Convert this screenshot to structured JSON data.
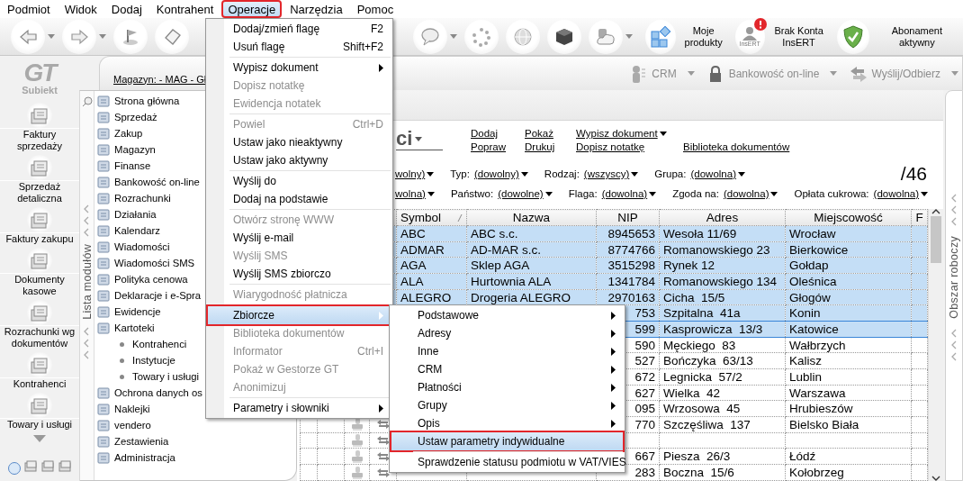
{
  "menu_bar": [
    {
      "label": "Podmiot",
      "selected": false
    },
    {
      "label": "Widok",
      "selected": false
    },
    {
      "label": "Dodaj",
      "selected": false
    },
    {
      "label": "Kontrahent",
      "selected": false
    },
    {
      "label": "Operacje",
      "selected": true
    },
    {
      "label": "Narzędzia",
      "selected": false
    },
    {
      "label": "Pomoc",
      "selected": false
    }
  ],
  "toolbar": {
    "shortcuts": [
      {
        "label": "Moje produkty",
        "alert": false
      },
      {
        "label": "Brak Konta InsERT",
        "icon_caption": "InsERT",
        "alert": true
      },
      {
        "label": "Abonament aktywny",
        "alert": false
      }
    ]
  },
  "left_nav": {
    "logo": {
      "mark": "GT",
      "name": "Subiekt"
    },
    "items": [
      {
        "label": "Faktury sprzedaży"
      },
      {
        "label": "Sprzedaż detaliczna"
      },
      {
        "label": "Faktury zakupu"
      },
      {
        "label": "Dokumenty kasowe"
      },
      {
        "label": "Rozrachunki wg dokumentów"
      },
      {
        "label": "Kontrahenci"
      },
      {
        "label": "Towary i usługi"
      }
    ]
  },
  "sub_bar": {
    "warehouse": "Magazyn: - MAG - Gł",
    "actions": [
      {
        "label": "CRM"
      },
      {
        "label": "Bankowość on-line"
      },
      {
        "label": "Wyślij/Odbierz"
      }
    ]
  },
  "modules": {
    "tab_label": "Lista modułów",
    "items": [
      {
        "label": "Strona główna"
      },
      {
        "label": "Sprzedaż"
      },
      {
        "label": "Zakup"
      },
      {
        "label": "Magazyn"
      },
      {
        "label": "Finanse"
      },
      {
        "label": "Bankowość on-line"
      },
      {
        "label": "Rozrachunki"
      },
      {
        "label": "Działania"
      },
      {
        "label": "Kalendarz"
      },
      {
        "label": "Wiadomości"
      },
      {
        "label": "Wiadomości SMS"
      },
      {
        "label": "Polityka cenowa"
      },
      {
        "label": "Deklaracje i e-Spra"
      },
      {
        "label": "Ewidencje"
      },
      {
        "label": "Kartoteki",
        "children": [
          {
            "label": "Kontrahenci"
          },
          {
            "label": "Instytucje"
          },
          {
            "label": "Towary i usługi"
          }
        ]
      },
      {
        "label": "Ochrona danych os"
      },
      {
        "label": "Naklejki"
      },
      {
        "label": "vendero"
      },
      {
        "label": "Zestawienia"
      },
      {
        "label": "Administracja"
      }
    ]
  },
  "content": {
    "title": "ci",
    "count": "/46",
    "action_rows": [
      [
        {
          "label": "Dodaj",
          "dropdown": false
        },
        {
          "label": "Pokaż",
          "dropdown": false
        },
        {
          "label": "Wypisz dokument",
          "dropdown": true
        }
      ],
      [
        {
          "label": "Popraw",
          "dropdown": false
        },
        {
          "label": "Drukuj",
          "dropdown": false
        },
        {
          "label": "Dopisz notatkę",
          "dropdown": false
        },
        {
          "label": "Biblioteka dokumentów",
          "dropdown": false
        }
      ]
    ],
    "filter_rows": [
      [
        {
          "value": "wolny)"
        },
        {
          "label": "Typ:",
          "value": "(dowolny)"
        },
        {
          "label": "Rodzaj:",
          "value": "(wszyscy)"
        },
        {
          "label": "Grupa:",
          "value": "(dowolna)"
        }
      ],
      [
        {
          "value": "wolna)"
        },
        {
          "label": "Państwo:",
          "value": "(dowolne)"
        },
        {
          "label": "Flaga:",
          "value": "(dowolna)"
        },
        {
          "label": "Zgoda na:",
          "value": "(dowolna)"
        },
        {
          "label": "Opłata cukrowa:",
          "value": "(dowolna)"
        }
      ]
    ]
  },
  "table": {
    "columns": [
      {
        "label": "Symbol",
        "sorted": true
      },
      {
        "label": "Nazwa",
        "sorted": false
      },
      {
        "label": "NIP",
        "sorted": false
      },
      {
        "label": "Adres",
        "sorted": false
      },
      {
        "label": "Miejscowość",
        "sorted": false
      },
      {
        "label": "F",
        "sorted": false
      }
    ],
    "rows": [
      {
        "symbol": "ABC",
        "name": "ABC s.c.",
        "nip": "8945653",
        "address": "Wesoła 11/69",
        "city": "Wrocław",
        "selected": true,
        "current": false
      },
      {
        "symbol": "ADMAR",
        "name": "AD-MAR s.c.",
        "nip": "8774766",
        "address": "Romanowskiego 23",
        "city": "Bierkowice",
        "selected": true,
        "current": false
      },
      {
        "symbol": "AGA",
        "name": "Sklep AGA",
        "nip": "3515298",
        "address": "Rynek 12",
        "city": "Gołdap",
        "selected": true,
        "current": false
      },
      {
        "symbol": "ALA",
        "name": "Hurtownia ALA",
        "nip": "1341784",
        "address": "Romanowskiego 134",
        "city": "Oleśnica",
        "selected": true,
        "current": false
      },
      {
        "symbol": "ALEGRO",
        "name": "Drogeria ALEGRO",
        "nip": "2970163",
        "address": "Cicha  15/5",
        "city": "Głogów",
        "selected": true,
        "current": false
      },
      {
        "nip": "753",
        "address": "Szpitalna  41a",
        "city": "Konin",
        "selected": true,
        "current": false
      },
      {
        "nip": "599",
        "address": "Kasprowicza  13/3",
        "city": "Katowice",
        "selected": true,
        "current": true
      },
      {
        "nip": "590",
        "address": "Męckiego  83",
        "city": "Wałbrzych",
        "selected": false,
        "current": false
      },
      {
        "nip": "527",
        "address": "Bończyka  63/13",
        "city": "Kalisz",
        "selected": false,
        "current": false
      },
      {
        "nip": "672",
        "address": "Legnicka  57/2",
        "city": "Lublin",
        "selected": false,
        "current": false
      },
      {
        "nip": "627",
        "address": "Wielka  42",
        "city": "Warszawa",
        "selected": false,
        "current": false
      },
      {
        "nip": "095",
        "address": "Wrzosowa  45",
        "city": "Hrubieszów",
        "selected": false,
        "current": false
      },
      {
        "nip": "770",
        "address": "Szczęśliwa  137",
        "city": "Bielsko Biała",
        "selected": false,
        "current": false
      },
      {
        "selected": false,
        "current": false
      },
      {
        "nip": "667",
        "address": "Piesza  26/3",
        "city": "Łódź",
        "selected": false,
        "current": false
      },
      {
        "nip": "283",
        "address": "Boczna  15/6",
        "city": "Kołobrzeg",
        "selected": false,
        "current": false
      }
    ]
  },
  "right_strip": {
    "label": "Obszar roboczy"
  },
  "operations_menu": {
    "groups": [
      [
        {
          "label": "Dodaj/zmień flagę",
          "shortcut": "F2",
          "disabled": false,
          "has_submenu": false,
          "selected": false
        },
        {
          "label": "Usuń flagę",
          "shortcut": "Shift+F2",
          "disabled": false,
          "has_submenu": false,
          "selected": false
        }
      ],
      [
        {
          "label": "Wypisz dokument",
          "disabled": false,
          "has_submenu": true,
          "selected": false
        },
        {
          "label": "Dopisz notatkę",
          "disabled": true,
          "has_submenu": false,
          "selected": false
        },
        {
          "label": "Ewidencja notatek",
          "disabled": true,
          "has_submenu": false,
          "selected": false
        }
      ],
      [
        {
          "label": "Powiel",
          "shortcut": "Ctrl+D",
          "disabled": true,
          "has_submenu": false,
          "selected": false
        },
        {
          "label": "Ustaw jako nieaktywny",
          "disabled": false,
          "has_submenu": false,
          "selected": false
        },
        {
          "label": "Ustaw jako aktywny",
          "disabled": false,
          "has_submenu": false,
          "selected": false
        }
      ],
      [
        {
          "label": "Wyślij do",
          "disabled": false,
          "has_submenu": false,
          "selected": false
        },
        {
          "label": "Dodaj na podstawie",
          "disabled": false,
          "has_submenu": false,
          "selected": false
        }
      ],
      [
        {
          "label": "Otwórz stronę WWW",
          "disabled": true,
          "has_submenu": false,
          "selected": false
        },
        {
          "label": "Wyślij e-mail",
          "disabled": false,
          "has_submenu": false,
          "selected": false
        },
        {
          "label": "Wyślij SMS",
          "disabled": true,
          "has_submenu": false,
          "selected": false
        },
        {
          "label": "Wyślij SMS zbiorczo",
          "disabled": false,
          "has_submenu": false,
          "selected": false
        }
      ],
      [
        {
          "label": "Wiarygodność płatnicza",
          "disabled": true,
          "has_submenu": false,
          "selected": false
        }
      ],
      [
        {
          "label": "Zbiorcze",
          "disabled": false,
          "has_submenu": true,
          "selected": true
        },
        {
          "label": "Biblioteka dokumentów",
          "disabled": true,
          "has_submenu": false,
          "selected": false
        },
        {
          "label": "Informator",
          "shortcut": "Ctrl+I",
          "disabled": true,
          "has_submenu": false,
          "selected": false
        },
        {
          "label": "Pokaż w Gestorze GT",
          "disabled": true,
          "has_submenu": false,
          "selected": false
        },
        {
          "label": "Anonimizuj",
          "disabled": true,
          "has_submenu": false,
          "selected": false
        }
      ],
      [
        {
          "label": "Parametry i słowniki",
          "disabled": false,
          "has_submenu": true,
          "selected": false
        }
      ]
    ]
  },
  "bulk_submenu": {
    "groups": [
      [
        {
          "label": "Podstawowe",
          "disabled": false,
          "has_submenu": true,
          "selected": false
        },
        {
          "label": "Adresy",
          "disabled": false,
          "has_submenu": true,
          "selected": false
        },
        {
          "label": "Inne",
          "disabled": false,
          "has_submenu": true,
          "selected": false
        },
        {
          "label": "CRM",
          "disabled": false,
          "has_submenu": true,
          "selected": false
        },
        {
          "label": "Płatności",
          "disabled": false,
          "has_submenu": true,
          "selected": false
        },
        {
          "label": "Grupy",
          "disabled": false,
          "has_submenu": true,
          "selected": false
        },
        {
          "label": "Opis",
          "disabled": false,
          "has_submenu": true,
          "selected": false
        },
        {
          "label": "Ustaw parametry indywidualne",
          "disabled": false,
          "has_submenu": false,
          "selected": true
        }
      ],
      [
        {
          "label": "Sprawdzenie statusu podmiotu w VAT/VIES",
          "disabled": false,
          "has_submenu": false,
          "selected": false
        }
      ]
    ]
  }
}
